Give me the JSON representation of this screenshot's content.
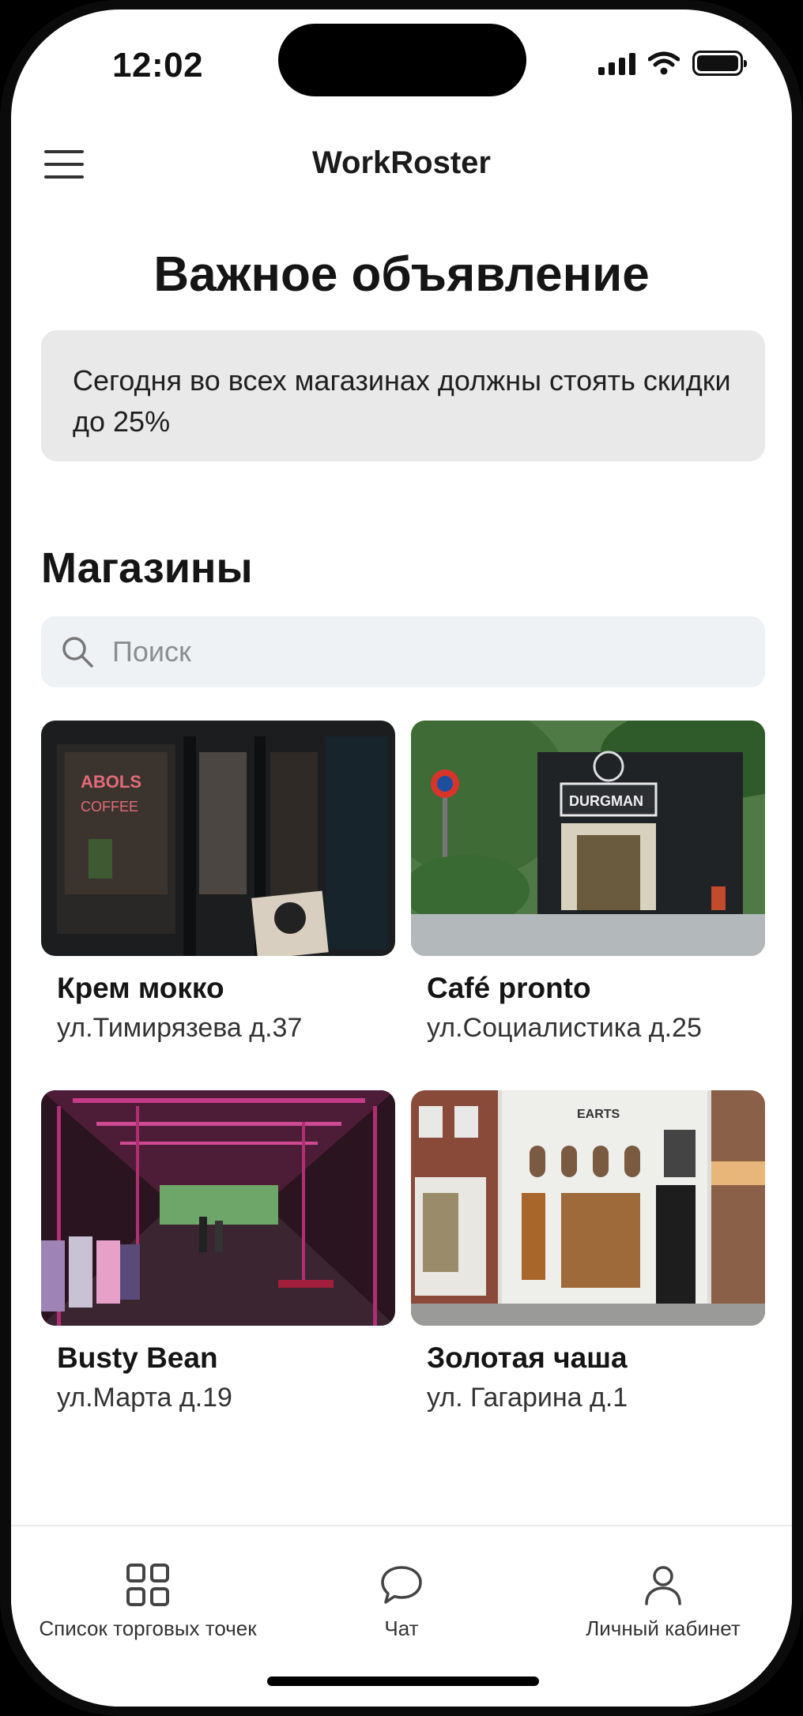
{
  "status_bar": {
    "time": "12:02"
  },
  "header": {
    "app_title": "WorkRoster",
    "menu_icon": "hamburger-menu-icon"
  },
  "announcement": {
    "title": "Важное объявление",
    "text": "Сегодня во всех магазинах должны стоять скидки до 25%"
  },
  "stores_section": {
    "title": "Магазины",
    "search": {
      "placeholder": "Поиск",
      "value": "",
      "icon": "search-icon"
    },
    "stores": [
      {
        "name": "Крем мокко",
        "address": "ул.Тимирязева д.37",
        "image": "dark coffee shop storefront with neon sign"
      },
      {
        "name": "Café pronto",
        "address": "ул.Социалистика д.25",
        "image": "cafe storefront among green trees"
      },
      {
        "name": "Busty Bean",
        "address": "ул.Марта д.19",
        "image": "clothing store interior with pink neon light"
      },
      {
        "name": "Золотая чаша",
        "address": "ул. Гагарина д.1",
        "image": "white street-corner shop facade"
      }
    ]
  },
  "bottom_nav": {
    "items": [
      {
        "label": "Список торговых точек",
        "icon": "grid-icon",
        "active": true
      },
      {
        "label": "Чат",
        "icon": "chat-bubble-icon",
        "active": false
      },
      {
        "label": "Личный кабинет",
        "icon": "user-icon",
        "active": false
      }
    ]
  },
  "colors": {
    "card_background": "#e9e9ea",
    "search_background": "#eef2f4",
    "text_primary": "#151515"
  }
}
